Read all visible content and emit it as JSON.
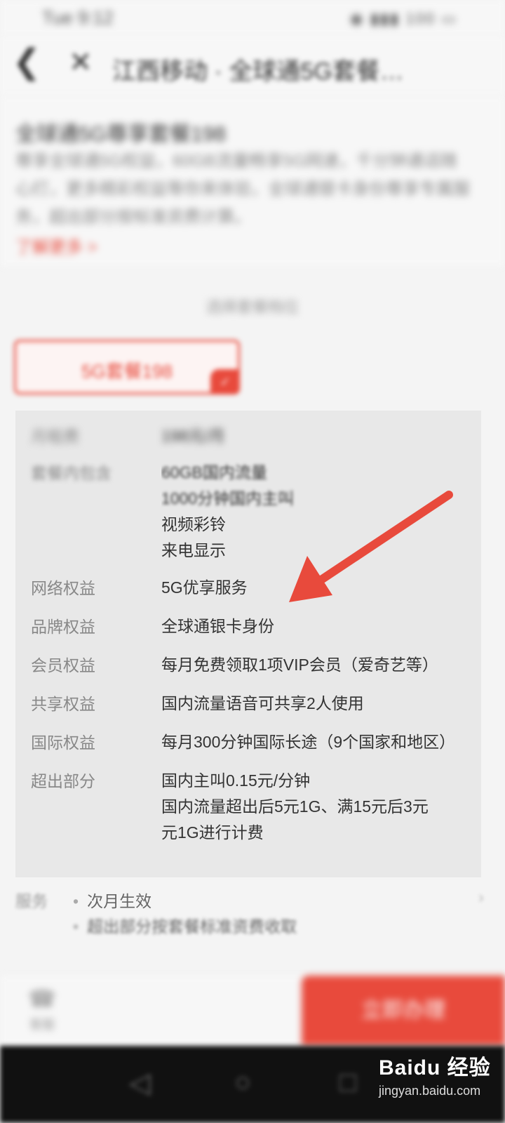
{
  "status_bar": {
    "time": "Tue 9:12",
    "icons": "◉ ▮▮▮ 100 ▭"
  },
  "nav": {
    "back_icon": "chevron-left",
    "close_icon": "close",
    "title": "江西移动 · 全球通5G套餐…"
  },
  "intro": {
    "product_name": "全球通5G尊享套餐198",
    "description": "尊享全球通5G权益，60GB流量畅享5G网速，千分钟通话随心打，更多精彩权益等你来体验，全球通银卡身份尊享专属服务，超出部分按标准资费计算。",
    "link": "了解更多 >"
  },
  "section_title": "选择套餐档位",
  "plan": {
    "label": "5G套餐198",
    "check_icon": "check-mark"
  },
  "details": {
    "rows": [
      {
        "label": "月租费",
        "values": [
          "198元/月"
        ]
      },
      {
        "label": "套餐内包含",
        "values": [
          "60GB国内流量",
          "1000分钟国内主叫",
          "视频彩铃",
          "来电显示"
        ]
      },
      {
        "label": "网络权益",
        "values": [
          "5G优享服务"
        ]
      },
      {
        "label": "品牌权益",
        "values": [
          "全球通银卡身份"
        ]
      },
      {
        "label": "会员权益",
        "values": [
          "每月免费领取1项VIP会员（爱奇艺等）"
        ]
      },
      {
        "label": "共享权益",
        "values": [
          "国内流量语音可共享2人使用"
        ]
      },
      {
        "label": "国际权益",
        "values": [
          "每月300分钟国际长途（9个国家和地区）"
        ]
      },
      {
        "label": "超出部分",
        "values": [
          "国内主叫0.15元/分钟",
          "国内流量超出后5元1G、满15元后3元",
          "元1G进行计费"
        ]
      }
    ]
  },
  "services": {
    "label": "服务",
    "items": [
      "次月生效",
      "超出部分按套餐标准资费收取"
    ],
    "chevron_icon": "chevron-right"
  },
  "bottom_bar": {
    "service_label": "客服",
    "service_icon": "headset",
    "buy_label": "立即办理"
  },
  "system_nav": {
    "back_icon": "triangle-back",
    "home_icon": "circle-home",
    "recent_icon": "square-recent"
  },
  "watermark": {
    "logo": "Baidu 经验",
    "url": "jingyan.baidu.com"
  },
  "colors": {
    "accent": "#e84a3c",
    "card_bg": "#e8e8e8",
    "arrow": "#e84a3c"
  }
}
